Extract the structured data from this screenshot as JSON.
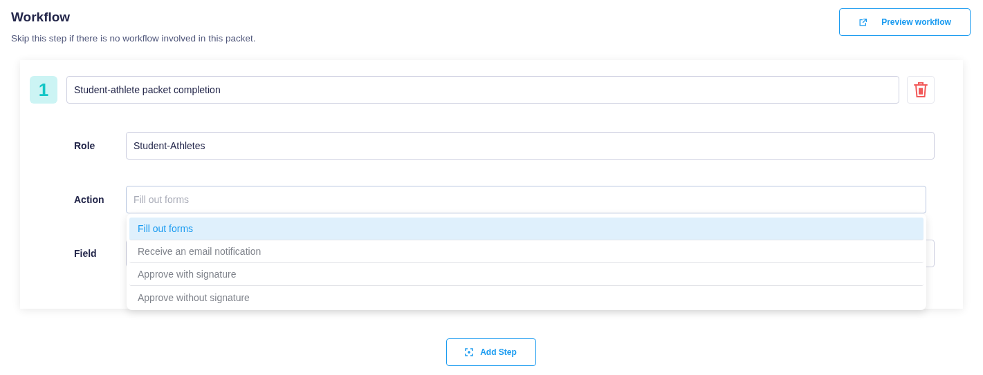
{
  "header": {
    "title": "Workflow",
    "subtitle": "Skip this step if there is no workflow involved in this packet.",
    "preview_button": "Preview workflow"
  },
  "steps": [
    {
      "number": "1",
      "title": "Student-athlete packet completion",
      "fields": [
        {
          "label": "Role",
          "value": "Student-Athletes"
        },
        {
          "label": "Action",
          "placeholder": "Fill out forms",
          "expanded": true,
          "options": [
            {
              "label": "Fill out forms",
              "selected": true
            },
            {
              "label": "Receive an email notification",
              "selected": false
            },
            {
              "label": "Approve with signature",
              "selected": false
            },
            {
              "label": "Approve without signature",
              "selected": false
            }
          ]
        },
        {
          "label": "Field"
        }
      ]
    }
  ],
  "add_step_button": "Add Step"
}
